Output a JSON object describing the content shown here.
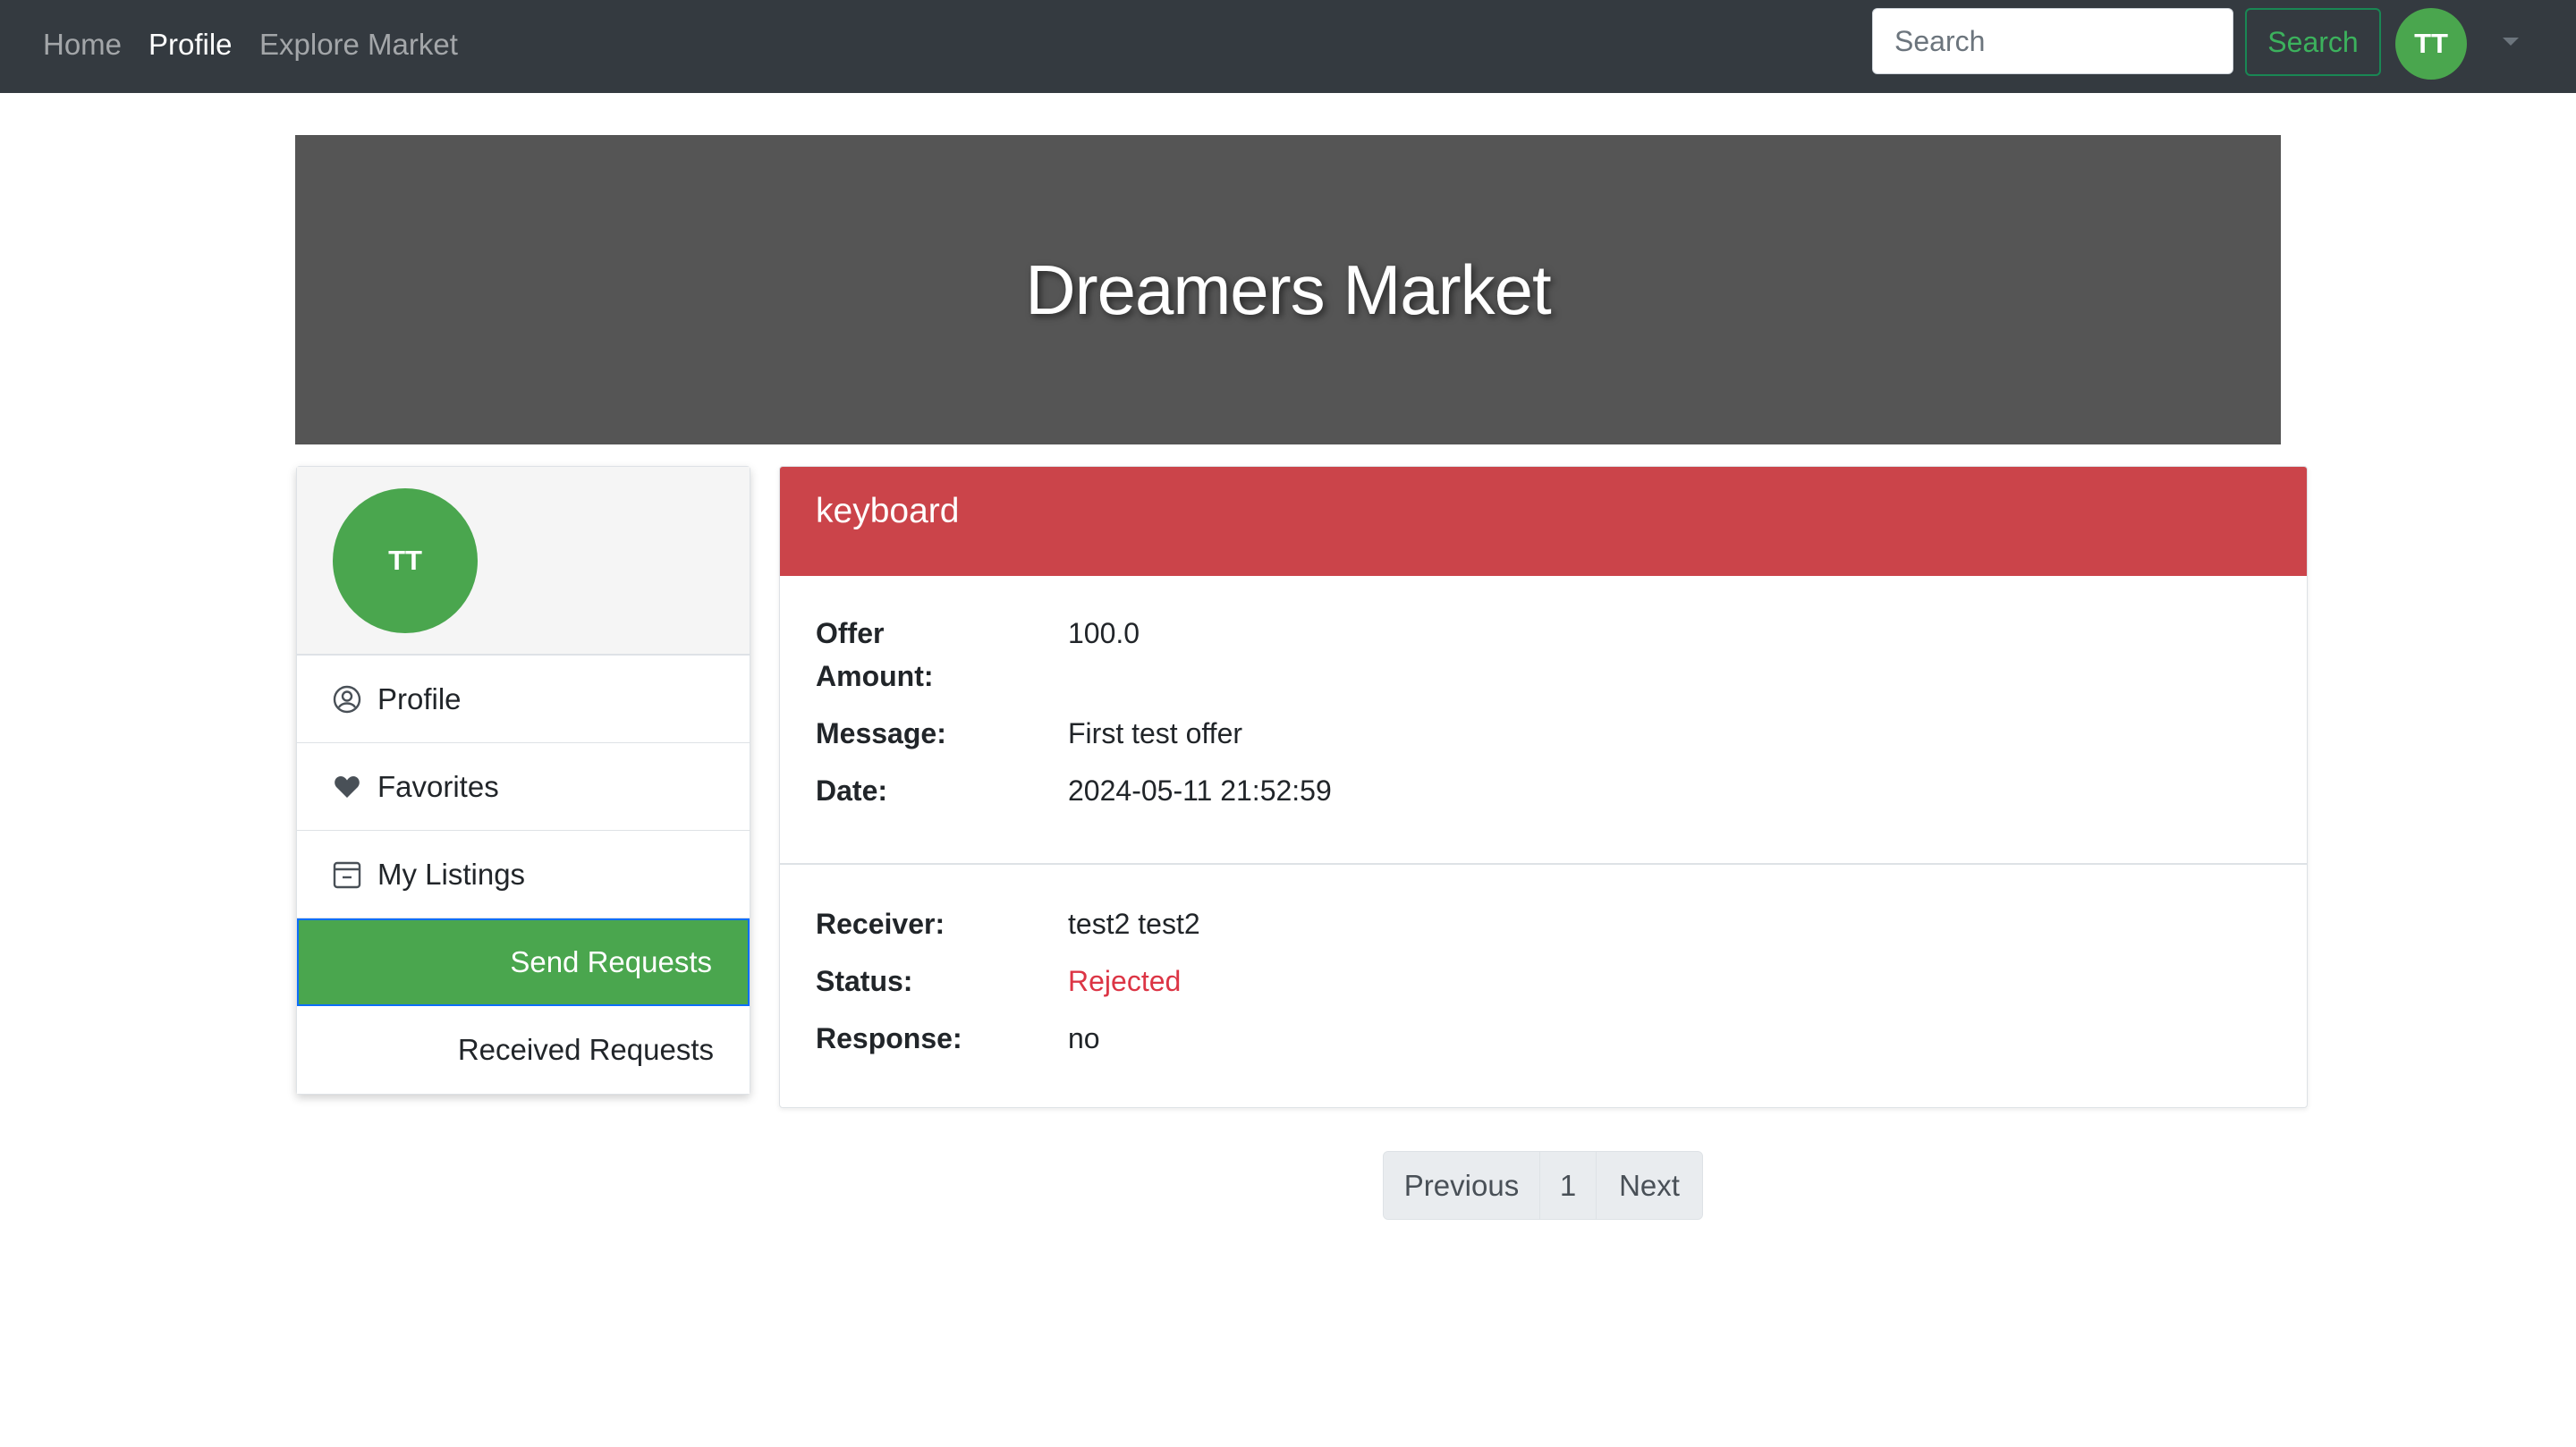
{
  "nav": {
    "links": [
      "Home",
      "Profile",
      "Explore Market"
    ],
    "search_placeholder": "Search",
    "search_button": "Search",
    "avatar_initials": "TT",
    "colors": {
      "background": "#343a40",
      "avatar": "#4aa64e",
      "search_button": "#198754"
    }
  },
  "banner": {
    "title": "Dreamers Market"
  },
  "sidebar": {
    "avatar_initials": "TT",
    "items": [
      {
        "label": "Profile",
        "icon": "user-circle-icon"
      },
      {
        "label": "Favorites",
        "icon": "heart-icon"
      },
      {
        "label": "My Listings",
        "icon": "calendar-minus-icon"
      },
      {
        "label": "Send Requests",
        "active": true
      },
      {
        "label": "Received Requests"
      }
    ],
    "active_color": "#4aa64e"
  },
  "offer": {
    "title": "keyboard",
    "header_color": "#cb444a",
    "fields": [
      {
        "label": "Offer Amount:",
        "value": "100.0"
      },
      {
        "label": "Message:",
        "value": "First test offer"
      },
      {
        "label": "Date:",
        "value": "2024-05-11 21:52:59"
      }
    ],
    "details": [
      {
        "label": "Receiver:",
        "value": "test2 test2"
      },
      {
        "label": "Status:",
        "value": "Rejected",
        "color": "#dc3545"
      },
      {
        "label": "Response:",
        "value": "no"
      }
    ]
  },
  "pagination": {
    "previous": "Previous",
    "current": "1",
    "next": "Next"
  }
}
